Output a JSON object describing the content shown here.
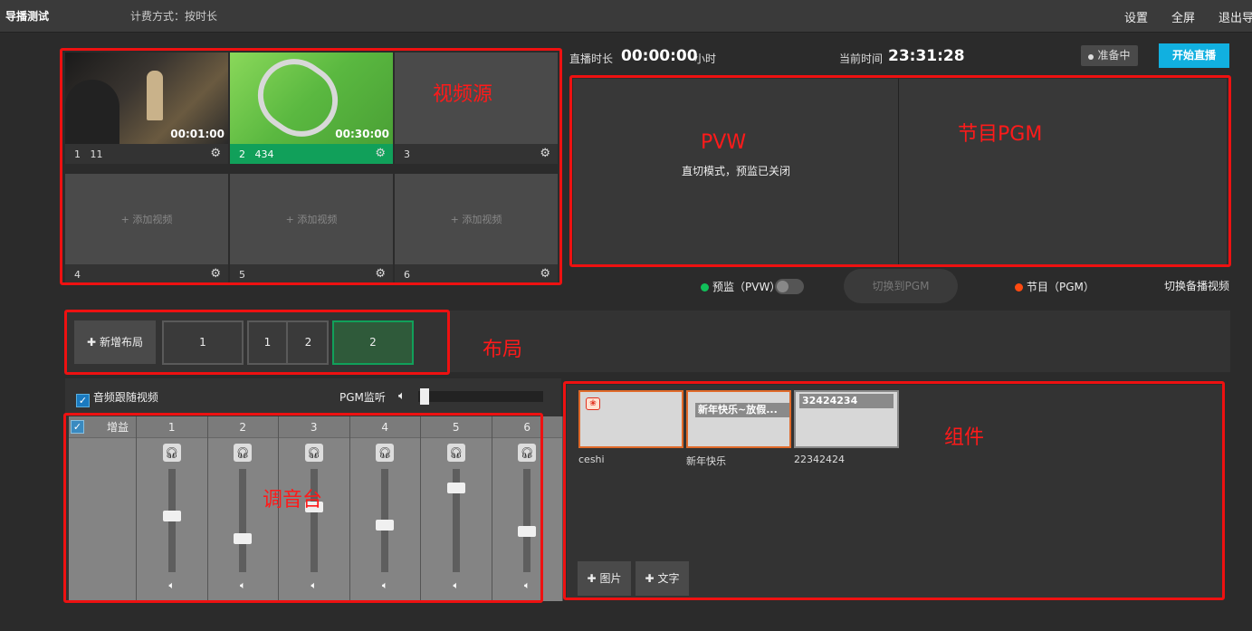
{
  "topbar": {
    "title": "导播测试",
    "billing": "计费方式：按时长",
    "nav": [
      "设置",
      "全屏",
      "退出导"
    ]
  },
  "sources": {
    "annotation": "视频源",
    "tiles": [
      {
        "index": "1",
        "name": "11",
        "time": "00:01:00"
      },
      {
        "index": "2",
        "name": "434",
        "time": "00:30:00"
      },
      {
        "index": "3",
        "name": "",
        "time": ""
      },
      {
        "index": "4",
        "name": "",
        "add": "+ 添加视频"
      },
      {
        "index": "5",
        "name": "",
        "add": "+ 添加视频"
      },
      {
        "index": "6",
        "name": "",
        "add": "+ 添加视频"
      }
    ]
  },
  "stats": {
    "duration_label": "直播时长",
    "duration_value": "00:00:00",
    "duration_unit": "小时",
    "time_label": "当前时间",
    "time_value": "23:31:28",
    "status": "准备中",
    "start_button": "开始直播"
  },
  "monitors": {
    "pvw_annotation": "PVW",
    "pvw_message": "直切模式，预监已关闭",
    "pgm_annotation": "节目PGM",
    "pvw_label": "预监（PVW）",
    "switch_button": "切换到PGM",
    "pgm_label": "节目（PGM）",
    "backup_link": "切换备播视频"
  },
  "layouts": {
    "annotation": "布局",
    "add_button": "新增布局",
    "items": [
      "1",
      "1",
      "2",
      "2"
    ]
  },
  "mixer": {
    "annotation": "调音台",
    "follow_video": "音频跟随视频",
    "pgm_monitor": "PGM监听",
    "gain_label": "增益",
    "channels": [
      "1",
      "2",
      "3",
      "4",
      "5",
      "6"
    ],
    "levels": [
      0.55,
      0.3,
      0.65,
      0.45,
      0.85,
      0.38
    ]
  },
  "components": {
    "annotation": "组件",
    "items": [
      {
        "name": "ceshi",
        "caption": ""
      },
      {
        "name": "新年快乐",
        "caption": "新年快乐~放假..."
      },
      {
        "name": "22342424",
        "caption": "32424234"
      }
    ],
    "add_image": "图片",
    "add_text": "文字"
  },
  "colors": {
    "accent": "#11b0e0",
    "active_green": "#11a05a",
    "annotation_red": "#ee1111",
    "pvw_dot": "#11c05a",
    "pgm_dot": "#ff4a10"
  }
}
